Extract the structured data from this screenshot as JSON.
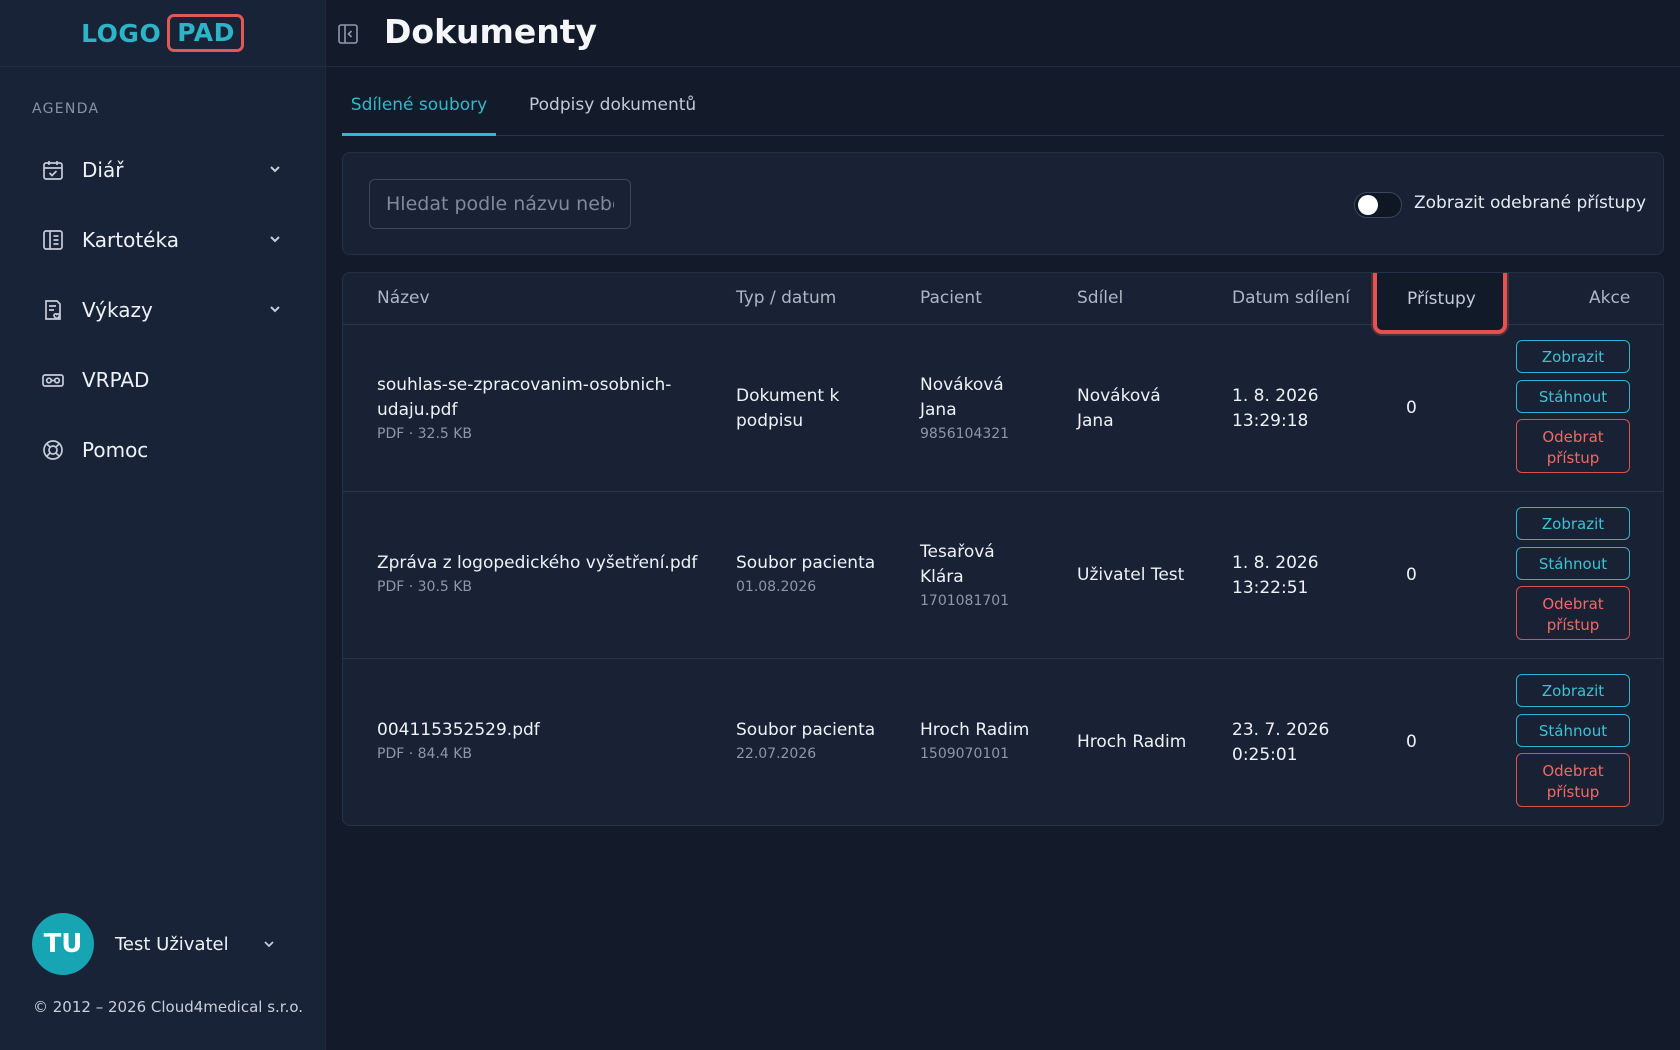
{
  "logo": {
    "part1": "LOGO",
    "part2": "PAD"
  },
  "sidebar": {
    "section_label": "AGENDA",
    "items": [
      {
        "label": "Diář",
        "icon": "calendar-icon",
        "has_chevron": true
      },
      {
        "label": "Kartotéka",
        "icon": "card-index-icon",
        "has_chevron": true
      },
      {
        "label": "Výkazy",
        "icon": "report-icon",
        "has_chevron": true
      },
      {
        "label": "VRPAD",
        "icon": "vr-headset-icon",
        "has_chevron": false
      },
      {
        "label": "Pomoc",
        "icon": "lifebuoy-icon",
        "has_chevron": false
      }
    ],
    "user": {
      "initials": "TU",
      "name": "Test Uživatel"
    },
    "copyright": "© 2012 – 2026 Cloud4medical s.r.o."
  },
  "header": {
    "title": "Dokumenty"
  },
  "tabs": [
    {
      "label": "Sdílené soubory",
      "active": true
    },
    {
      "label": "Podpisy dokumentů",
      "active": false
    }
  ],
  "filter": {
    "search_placeholder": "Hledat podle názvu nebo pacienta",
    "toggle_label": "Zobrazit odebrané přístupy",
    "toggle_on": false
  },
  "table": {
    "columns": [
      "Název",
      "Typ / datum",
      "Pacient",
      "Sdílel",
      "Datum sdílení",
      "Přístupy",
      "Akce"
    ],
    "rows": [
      {
        "name_line1": "souhlas-se-zpracovanim-osobnich-",
        "name_line2": "udaju.pdf",
        "file_meta": "PDF · 32.5 KB",
        "type_line1": "Dokument k",
        "type_line2": "podpisu",
        "type_date": "",
        "patient_line1": "Nováková",
        "patient_line2": "Jana",
        "patient_id": "9856104321",
        "shared_by_line1": "Nováková",
        "shared_by_line2": "Jana",
        "shared_date": "1. 8. 2026",
        "shared_time": "13:29:18",
        "access_count": "0"
      },
      {
        "name_line1": "Zpráva z logopedického vyšetření.pdf",
        "name_line2": "",
        "file_meta": "PDF · 30.5 KB",
        "type_line1": "Soubor pacienta",
        "type_line2": "",
        "type_date": "01.08.2026",
        "patient_line1": "Tesařová",
        "patient_line2": "Klára",
        "patient_id": "1701081701",
        "shared_by_line1": "Uživatel Test",
        "shared_by_line2": "",
        "shared_date": "1. 8. 2026",
        "shared_time": "13:22:51",
        "access_count": "0"
      },
      {
        "name_line1": "004115352529.pdf",
        "name_line2": "",
        "file_meta": "PDF · 84.4 KB",
        "type_line1": "Soubor pacienta",
        "type_line2": "",
        "type_date": "22.07.2026",
        "patient_line1": "Hroch Radim",
        "patient_line2": "",
        "patient_id": "1509070101",
        "shared_by_line1": "Hroch Radim",
        "shared_by_line2": "",
        "shared_date": "23. 7. 2026",
        "shared_time": "0:25:01",
        "access_count": "0"
      }
    ],
    "actions": {
      "view": "Zobrazit",
      "download": "Stáhnout",
      "revoke_line1": "Odebrat",
      "revoke_line2": "přístup"
    }
  },
  "colors": {
    "accent": "#2bb5c6",
    "danger": "#e5514c",
    "background": "#131b2b",
    "sidebar": "#192337"
  }
}
